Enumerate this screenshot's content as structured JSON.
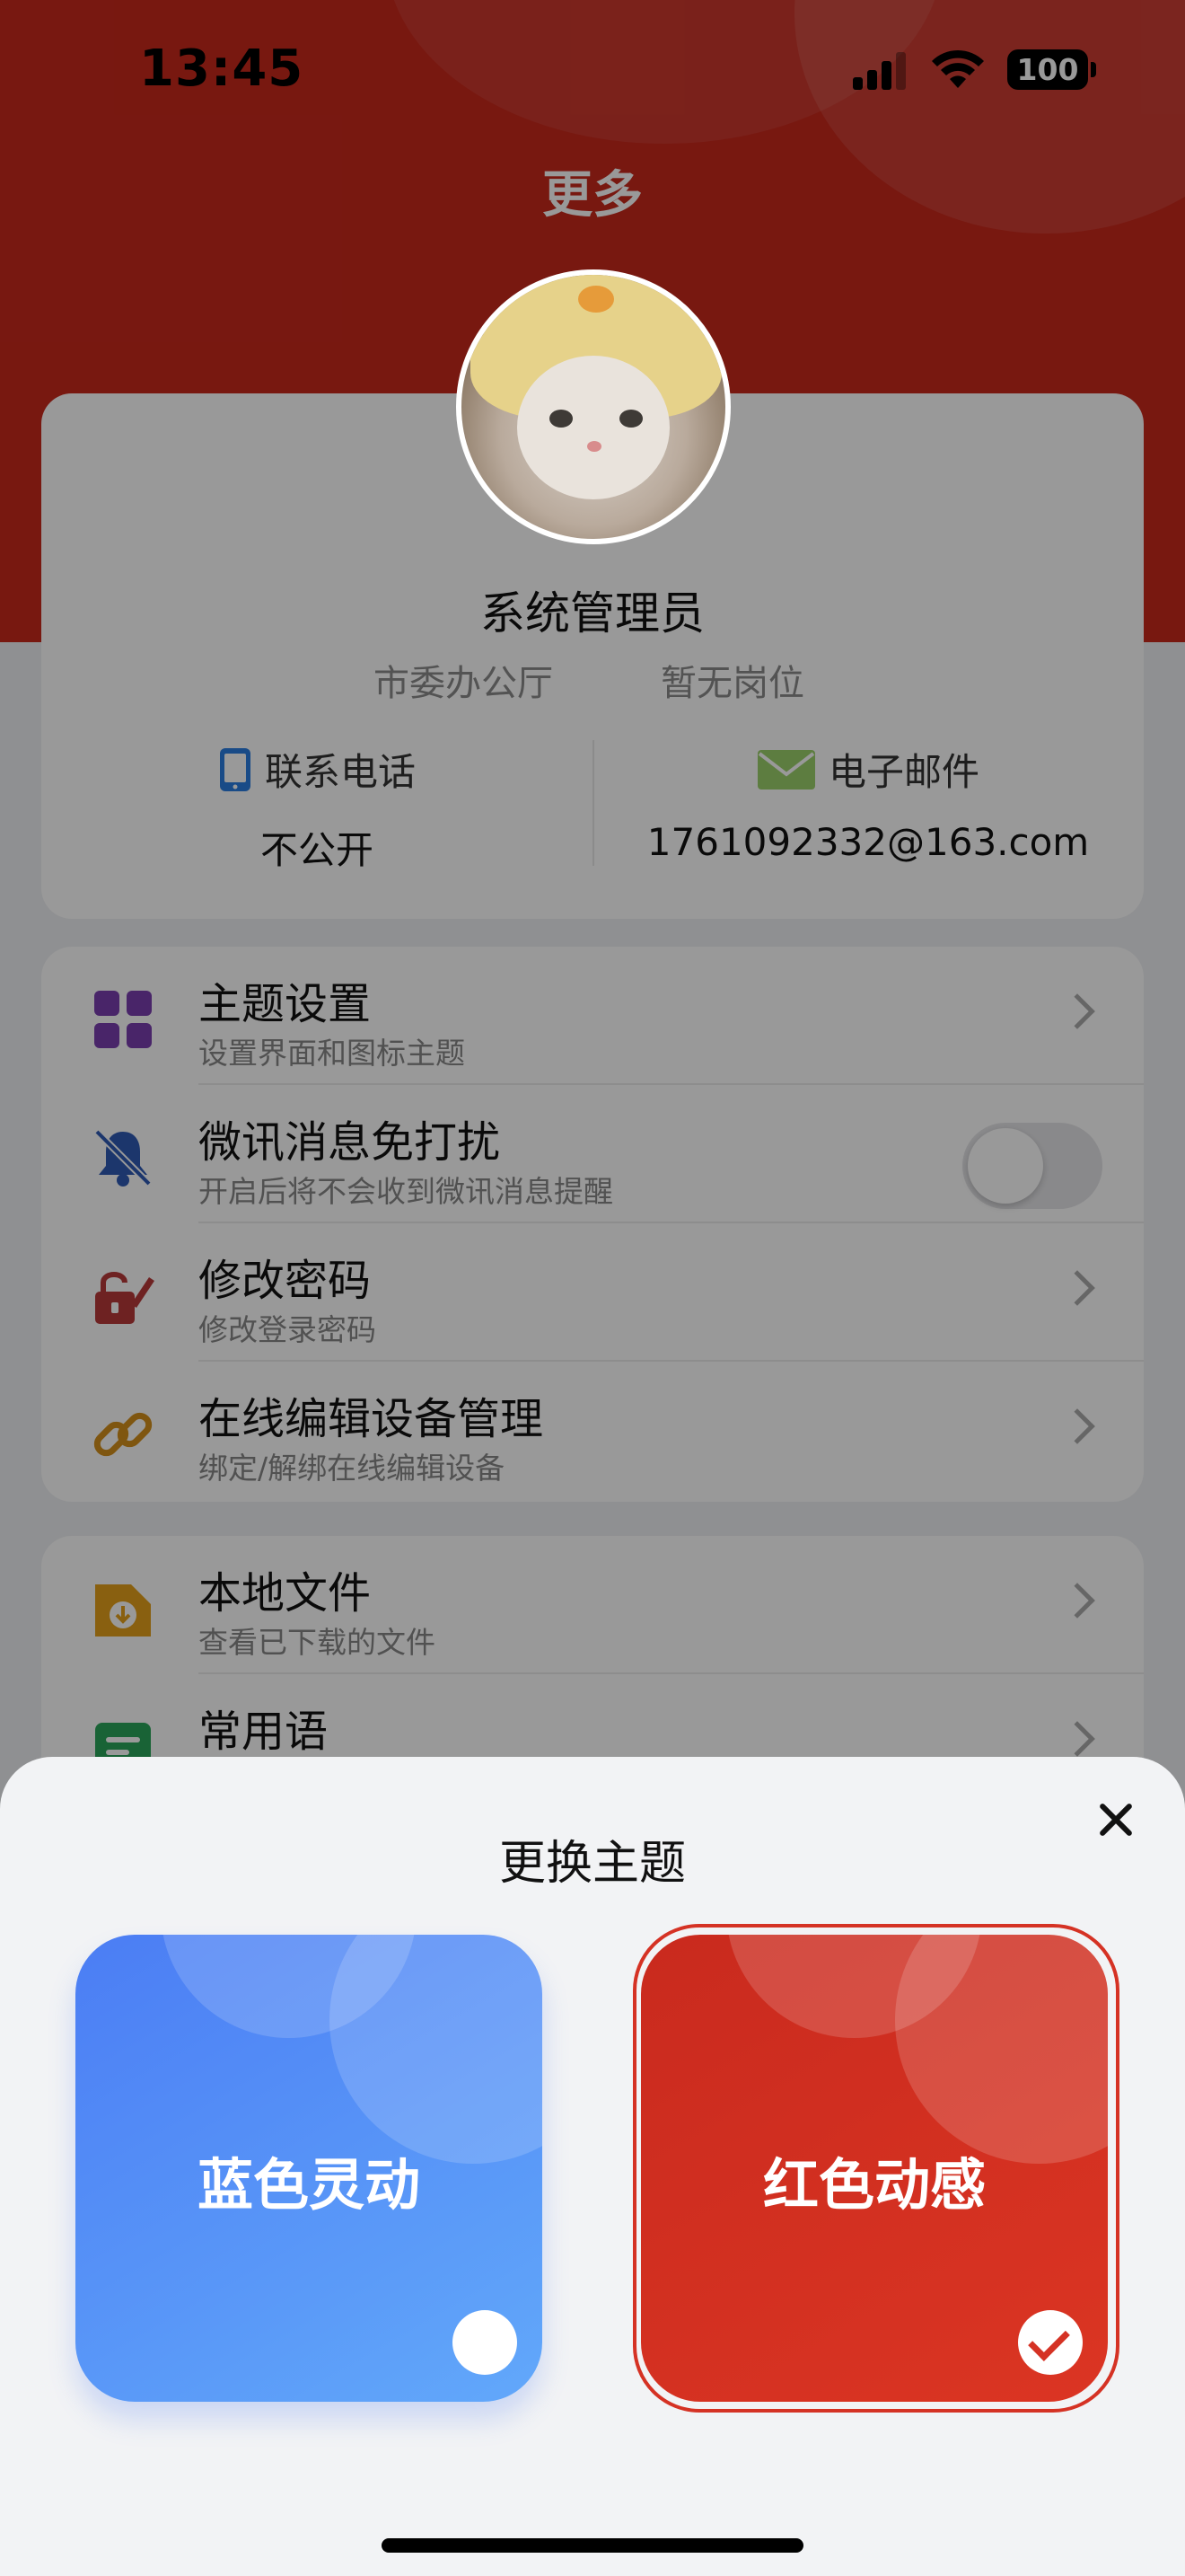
{
  "status_bar": {
    "time": "13:45",
    "battery": "100"
  },
  "header": {
    "title": "更多"
  },
  "profile": {
    "name": "系统管理员",
    "department": "市委办公厅",
    "position": "暂无岗位",
    "phone": {
      "label": "联系电话",
      "value": "不公开"
    },
    "email": {
      "label": "电子邮件",
      "value": "1761092332@163.com"
    }
  },
  "menu_group_1": [
    {
      "title": "主题设置",
      "subtitle": "设置界面和图标主题"
    },
    {
      "title": "微讯消息免打扰",
      "subtitle": "开启后将不会收到微讯消息提醒"
    },
    {
      "title": "修改密码",
      "subtitle": "修改登录密码"
    },
    {
      "title": "在线编辑设备管理",
      "subtitle": "绑定/解绑在线编辑设备"
    }
  ],
  "menu_group_2": [
    {
      "title": "本地文件",
      "subtitle": "查看已下载的文件"
    },
    {
      "title": "常用语",
      "subtitle": ""
    }
  ],
  "dnd_toggle_on": false,
  "theme_sheet": {
    "title": "更换主题",
    "options": [
      {
        "label": "蓝色灵动",
        "selected": false
      },
      {
        "label": "红色动感",
        "selected": true
      }
    ]
  },
  "colors": {
    "brand_red": "#c8281c",
    "brand_blue": "#4b7df4"
  },
  "icons": [
    "grid-icon",
    "bell-mute-icon",
    "lock-edit-icon",
    "link-icon",
    "folder-download-icon",
    "message-icon",
    "phone-icon",
    "mail-icon",
    "close-icon",
    "check-icon"
  ]
}
